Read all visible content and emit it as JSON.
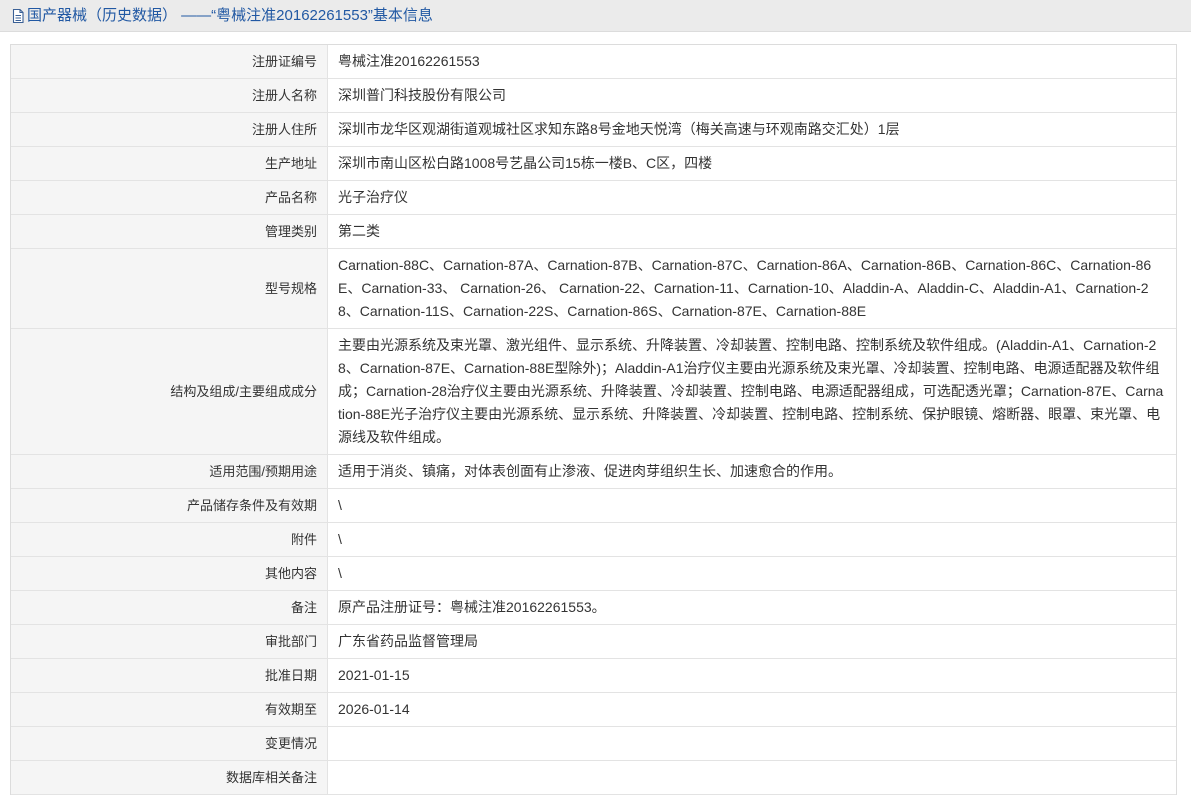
{
  "header": {
    "icon": "document-icon",
    "title": "国产器械（历史数据） ——“粤械注准20162261553”基本信息"
  },
  "record": {
    "rows": [
      {
        "label": "注册证编号",
        "value": "粤械注准20162261553"
      },
      {
        "label": "注册人名称",
        "value": "深圳普门科技股份有限公司"
      },
      {
        "label": "注册人住所",
        "value": "深圳市龙华区观湖街道观城社区求知东路8号金地天悦湾（梅关高速与环观南路交汇处）1层"
      },
      {
        "label": "生产地址",
        "value": "深圳市南山区松白路1008号艺晶公司15栋一楼B、C区，四楼"
      },
      {
        "label": "产品名称",
        "value": "光子治疗仪"
      },
      {
        "label": "管理类别",
        "value": "第二类"
      },
      {
        "label": "型号规格",
        "value": "Carnation-88C、Carnation-87A、Carnation-87B、Carnation-87C、Carnation-86A、Carnation-86B、Carnation-86C、Carnation-86E、Carnation-33、 Carnation-26、 Carnation-22、Carnation-11、Carnation-10、Aladdin-A、Aladdin-C、Aladdin-A1、Carnation-28、Carnation-11S、Carnation-22S、Carnation-86S、Carnation-87E、Carnation-88E"
      },
      {
        "label": "结构及组成/主要组成成分",
        "value": "主要由光源系统及束光罩、激光组件、显示系统、升降装置、冷却装置、控制电路、控制系统及软件组成。(Aladdin-A1、Carnation-28、Carnation-87E、Carnation-88E型除外)；Aladdin-A1治疗仪主要由光源系统及束光罩、冷却装置、控制电路、电源适配器及软件组成；Carnation-28治疗仪主要由光源系统、升降装置、冷却装置、控制电路、电源适配器组成，可选配透光罩；Carnation-87E、Carnation-88E光子治疗仪主要由光源系统、显示系统、升降装置、冷却装置、控制电路、控制系统、保护眼镜、熔断器、眼罩、束光罩、电源线及软件组成。"
      },
      {
        "label": "适用范围/预期用途",
        "value": "适用于消炎、镇痛，对体表创面有止渗液、促进肉芽组织生长、加速愈合的作用。"
      },
      {
        "label": "产品储存条件及有效期",
        "value": "\\"
      },
      {
        "label": "附件",
        "value": "\\"
      },
      {
        "label": "其他内容",
        "value": "\\"
      },
      {
        "label": "备注",
        "value": "原产品注册证号：粤械注准20162261553。"
      },
      {
        "label": "审批部门",
        "value": "广东省药品监督管理局"
      },
      {
        "label": "批准日期",
        "value": "2021-01-15"
      },
      {
        "label": "有效期至",
        "value": "2026-01-14"
      },
      {
        "label": "变更情况",
        "value": ""
      },
      {
        "label": "数据库相关备注",
        "value": ""
      }
    ]
  },
  "colors": {
    "accent": "#2158a3",
    "header_bg": "#ebebeb",
    "header_border": "#dcdcdc",
    "border": "#dcdcdc",
    "row_border": "#e3e3e3",
    "label_bg": "#f5f5f5",
    "text": "#333333",
    "icon": "#3a6096"
  }
}
